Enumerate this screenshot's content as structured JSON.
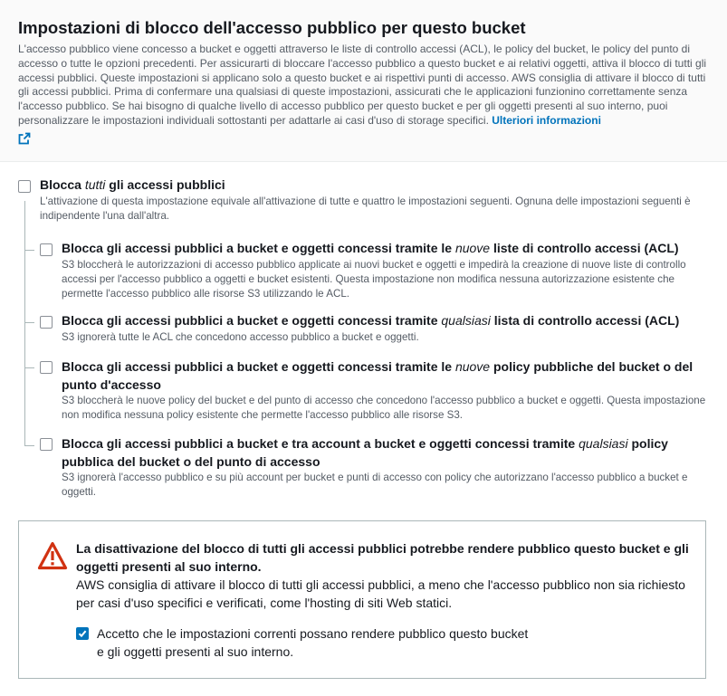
{
  "header": {
    "title": "Impostazioni di blocco dell'accesso pubblico per questo bucket",
    "description": "L'accesso pubblico viene concesso a bucket e oggetti attraverso le liste di controllo accessi (ACL), le policy del bucket, le policy del punto di accesso o tutte le opzioni precedenti. Per assicurarti di bloccare l'accesso pubblico a questo bucket e ai relativi oggetti, attiva il blocco di tutti gli accessi pubblici. Queste impostazioni si applicano solo a questo bucket e ai rispettivi punti di accesso. AWS consiglia di attivare il blocco di tutti gli accessi pubblici. Prima di confermare una qualsiasi di queste impostazioni, assicurati che le applicazioni funzionino correttamente senza l'accesso pubblico. Se hai bisogno di qualche livello di accesso pubblico per questo bucket e per gli oggetti presenti al suo interno, puoi personalizzare le impostazioni individuali sottostanti per adattarle ai casi d'uso di storage specifici.",
    "learn_more_label": "Ulteriori informazioni",
    "external_link_icon": "external-link-icon"
  },
  "block_all": {
    "title_prefix": "Blocca ",
    "title_emphasis": "tutti",
    "title_suffix": " gli accessi pubblici",
    "description": "L'attivazione di questa impostazione equivale all'attivazione di tutte e quattro le impostazioni seguenti. Ognuna delle impostazioni seguenti è indipendente l'una dall'altra.",
    "checked": false
  },
  "options": [
    {
      "title_prefix": "Blocca gli accessi pubblici a bucket e oggetti concessi tramite le ",
      "title_emphasis": "nuove",
      "title_suffix": " liste di controllo accessi (ACL)",
      "description": "S3 bloccherà le autorizzazioni di accesso pubblico applicate ai nuovi bucket e oggetti e impedirà la creazione di nuove liste di controllo accessi per l'accesso pubblico a oggetti e bucket esistenti. Questa impostazione non modifica nessuna autorizzazione esistente che permette l'accesso pubblico alle risorse S3 utilizzando le ACL.",
      "checked": false
    },
    {
      "title_prefix": "Blocca gli accessi pubblici a bucket e oggetti concessi tramite ",
      "title_emphasis": "qualsiasi",
      "title_suffix": " lista di controllo accessi (ACL)",
      "description": "S3 ignorerà tutte le ACL che concedono accesso pubblico a bucket e oggetti.",
      "checked": false
    },
    {
      "title_prefix": "Blocca gli accessi pubblici a bucket e oggetti concessi tramite le ",
      "title_emphasis": "nuove",
      "title_suffix": " policy pubbliche del bucket o del punto d'accesso",
      "description": "S3 bloccherà le nuove policy del bucket e del punto di accesso che concedono l'accesso pubblico a bucket e oggetti. Questa impostazione non modifica nessuna policy esistente che permette l'accesso pubblico alle risorse S3.",
      "checked": false
    },
    {
      "title_prefix": "Blocca gli accessi pubblici a bucket e tra account a bucket e oggetti concessi tramite ",
      "title_emphasis": "qualsiasi",
      "title_suffix": " policy pubblica del bucket o del punto di accesso",
      "description": "S3 ignorerà l'accesso pubblico e su più account per bucket e punti di accesso con policy che autorizzano l'accesso pubblico a bucket e oggetti.",
      "checked": false
    }
  ],
  "alert": {
    "icon": "warning-icon",
    "title": "La disattivazione del blocco di tutti gli accessi pubblici potrebbe rendere pubblico questo bucket e gli oggetti presenti al suo interno.",
    "body": "AWS consiglia di attivare il blocco di tutti gli accessi pubblici, a meno che l'accesso pubblico non sia richiesto per casi d'uso specifici e verificati, come l'hosting di siti Web statici.",
    "ack_label": "Accetto che le impostazioni correnti possano rendere pubblico questo bucket e gli oggetti presenti al suo interno.",
    "ack_checked": true
  },
  "colors": {
    "link": "#0073bb",
    "checkbox_checked": "#0073bb",
    "warning": "#d13212"
  }
}
